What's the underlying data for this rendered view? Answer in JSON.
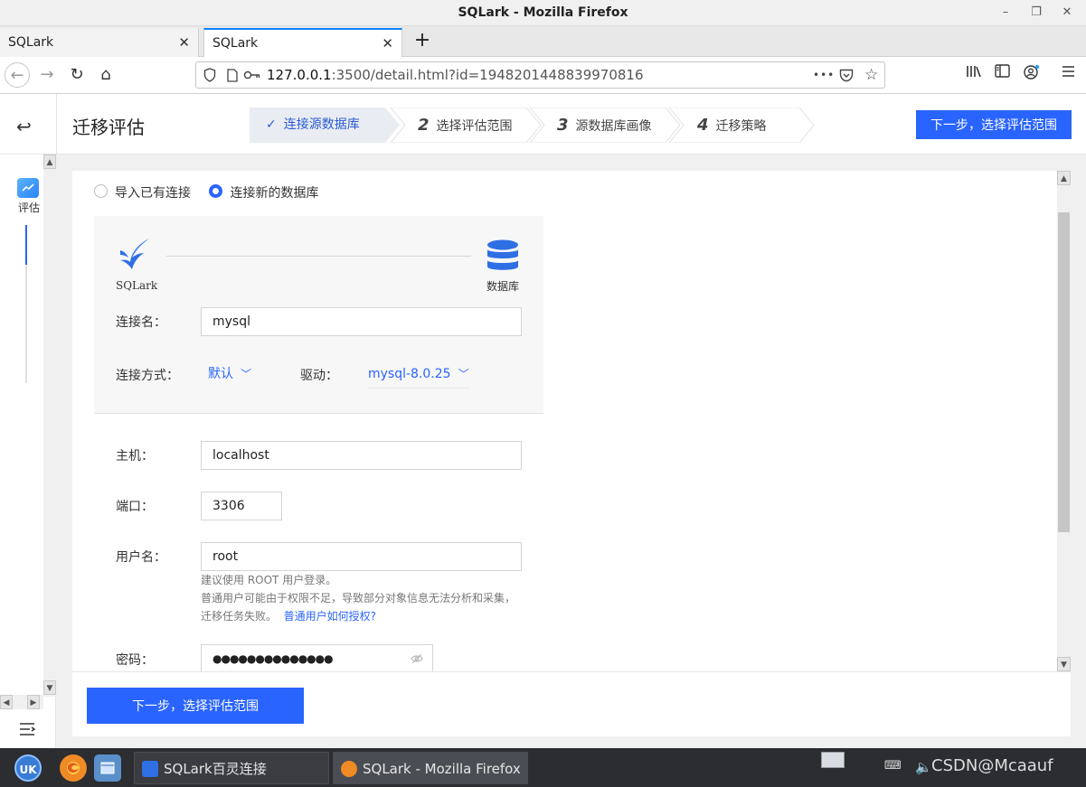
{
  "window": {
    "title": "SQLark - Mozilla Firefox",
    "minimize": "–",
    "maximize": "❐",
    "close": "✕"
  },
  "tabs": [
    {
      "label": "SQLark",
      "close": "✕"
    },
    {
      "label": "SQLark",
      "close": "✕"
    }
  ],
  "new_tab": "+",
  "nav": {
    "back": "←",
    "forward": "→",
    "reload": "↻",
    "home": "⌂",
    "url_host": "127.0.0.1",
    "url_rest": ":3500/detail.html?id=1948201448839970816",
    "more": "•••"
  },
  "app": {
    "back": "↩",
    "title": "迁移评估",
    "steps": [
      {
        "num": "",
        "label": "连接源数据库",
        "done": true
      },
      {
        "num": "2",
        "label": "选择评估范围"
      },
      {
        "num": "3",
        "label": "源数据库画像"
      },
      {
        "num": "4",
        "label": "迁移策略"
      }
    ],
    "header_next": "下一步，选择评估范围"
  },
  "sidebar": {
    "items": [
      {
        "label": "评估"
      }
    ],
    "menu": "☰"
  },
  "form": {
    "radio_existing": "导入已有连接",
    "radio_new": "连接新的数据库",
    "logo_left": "SQLark",
    "logo_right": "数据库",
    "conn_name_label": "连接名：",
    "conn_name_value": "mysql",
    "conn_method_label": "连接方式：",
    "conn_method_value": "默认",
    "driver_label": "驱动：",
    "driver_value": "mysql-8.0.25",
    "host_label": "主机：",
    "host_value": "localhost",
    "port_label": "端口：",
    "port_value": "3306",
    "user_label": "用户名：",
    "user_value": "root",
    "hint1": "建议使用 ROOT 用户登录。",
    "hint2": "普通用户可能由于权限不足，导致部分对象信息无法分析和采集，",
    "hint3": "迁移任务失败。",
    "hint_link": "普通用户如何授权?",
    "password_label": "密码：",
    "password_value": "●●●●●●●●●●●●●●"
  },
  "footer_next": "下一步，选择评估范围",
  "taskbar": {
    "tasks": [
      {
        "label": "SQLark百灵连接"
      },
      {
        "label": "SQLark - Mozilla Firefox"
      }
    ],
    "tray_text": "CSDN@Mcaauf"
  }
}
